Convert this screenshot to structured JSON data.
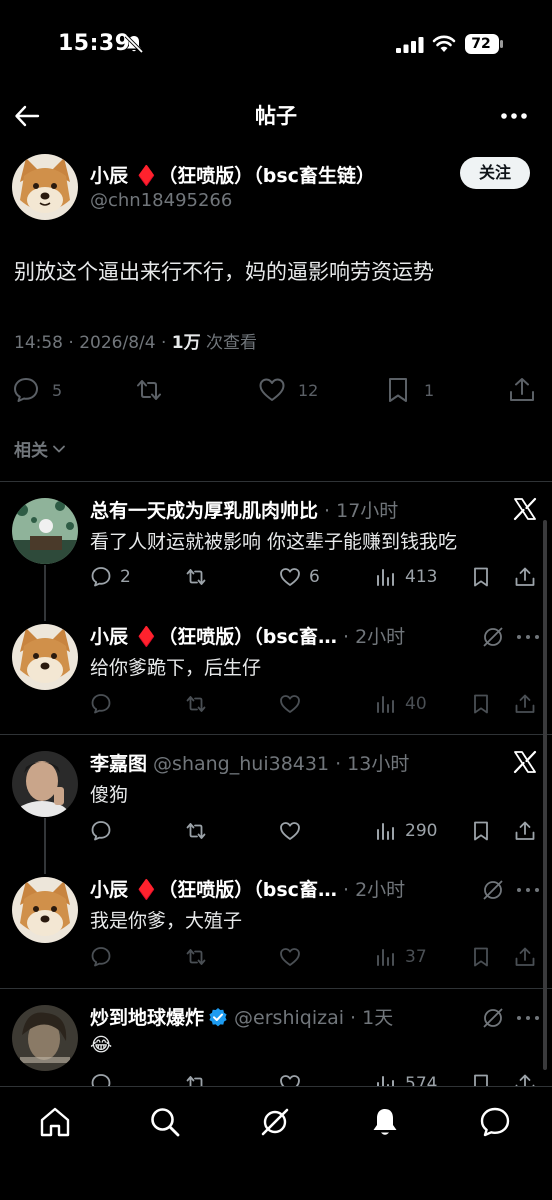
{
  "status_bar": {
    "time": "15:39",
    "battery": "72"
  },
  "header": {
    "title": "帖子"
  },
  "post": {
    "author_name": "小辰 ♦️（狂喷版）（bsc畜生链）",
    "author_handle": "@chn18495266",
    "follow_label": "关注",
    "text": "别放这个逼出来行不行，妈的逼影响劳资运势",
    "time": "14:58 · 2026/8/4 · ",
    "views_count": "1万",
    "views_label": " 次查看",
    "replies": "5",
    "likes": "12",
    "bookmarks": "1"
  },
  "related_label": "相关",
  "replies": [
    {
      "name": "总有一天成为厚乳肌肉帅比",
      "sub": " · 17小时",
      "text": "看了人财运就被影响 你这辈子能赚到钱我吃",
      "replies": "2",
      "likes": "6",
      "views": "413"
    },
    {
      "name": "小辰 ♦️（狂喷版）（bsc畜…",
      "sub": " · 2小时",
      "text": "给你爹跪下，后生仔",
      "replies": "",
      "likes": "",
      "views": "40"
    },
    {
      "name": "李嘉图",
      "sub": " @shang_hui38431 · 13小时",
      "text": "傻狗",
      "replies": "",
      "likes": "",
      "views": "290"
    },
    {
      "name": "小辰 ♦️（狂喷版）（bsc畜…",
      "sub": " · 2小时",
      "text": "我是你爹，大殖子",
      "replies": "",
      "likes": "",
      "views": "37"
    },
    {
      "name": "炒到地球爆炸",
      "sub": " @ershiqizai · 1天",
      "text": "😂",
      "replies": "",
      "likes": "",
      "views": "574"
    }
  ],
  "colors": {
    "background": "#000000",
    "muted": "#71767b",
    "verified": "#1d9bf0",
    "diamond": "#e0245e"
  }
}
